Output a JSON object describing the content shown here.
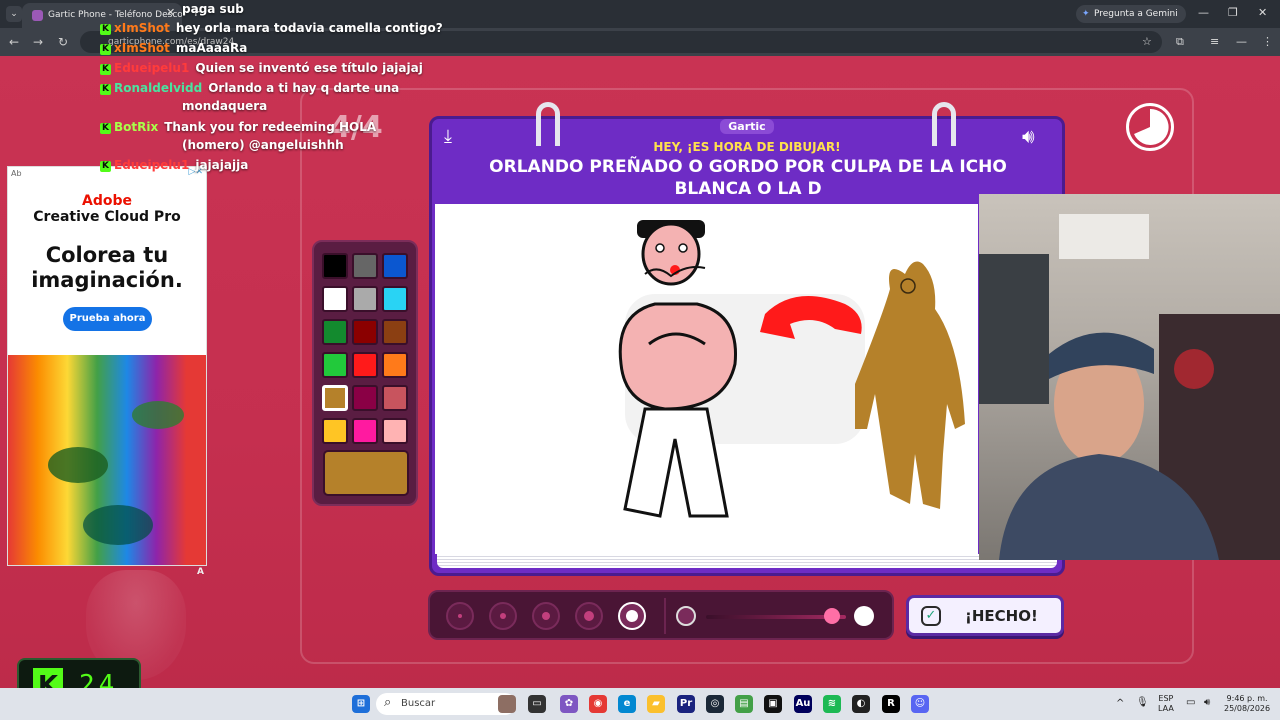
{
  "browser": {
    "tab_title": "Gartic Phone - Teléfono Descon",
    "url": "garticphone.com/es/draw24",
    "gemini_label": "Pregunta a Gemini"
  },
  "chat": [
    {
      "user": "",
      "user_color": "#ffffff",
      "message": "paga sub",
      "badge": false
    },
    {
      "user": "xImShot",
      "user_color": "#ff7a1a",
      "message": "hey orla mara todavia camella contigo?",
      "badge": true
    },
    {
      "user": "xImShot",
      "user_color": "#ff7a1a",
      "message": "maAaaaRa",
      "badge": true
    },
    {
      "user": "Edueipelu1",
      "user_color": "#ff3b3b",
      "message": "Quien se inventó ese título jajajaj",
      "badge": true
    },
    {
      "user": "Ronaldelvidd",
      "user_color": "#4ae3a0",
      "message": "Orlando a ti hay q darte una",
      "badge": true
    },
    {
      "user": "",
      "user_color": "#ffffff",
      "message": "mondaquera",
      "badge": false
    },
    {
      "user": "BotRix",
      "user_color": "#a8ff4a",
      "message": "Thank you for redeeming HOLA",
      "badge": true
    },
    {
      "user": "",
      "user_color": "#ffffff",
      "message": "(homero) @angeluishhh",
      "badge": false
    },
    {
      "user": "Edueipelu1",
      "user_color": "#ff3b3b",
      "message": "jajajajja",
      "badge": true
    }
  ],
  "ad": {
    "label": "Ab",
    "brand": "Adobe",
    "product": "Creative Cloud Pro",
    "headline_line1": "Colorea tu",
    "headline_line2": "imaginación.",
    "cta": "Prueba ahora",
    "corner": "A"
  },
  "kick_counter": {
    "value": "24"
  },
  "game": {
    "round": "4/4",
    "logo": "Gartic",
    "subtitle": "HEY, ¡ES HORA DE DIBUJAR!",
    "prompt_line1": "ORLANDO PREÑADO O GORDO POR CULPA DE LA ICHO",
    "prompt_line2": "BLANCA O LA D",
    "done_label": "¡HECHO!",
    "selected_color": "#b5812a",
    "palette": [
      "#000000",
      "#666666",
      "#0b57d0",
      "#ffffff",
      "#aaaaaa",
      "#29d3f4",
      "#138a2e",
      "#8b0000",
      "#8b3f12",
      "#22c93b",
      "#ff1a1a",
      "#ff7a1a",
      "#b5812a",
      "#8a0045",
      "#c8545e",
      "#ffc524",
      "#ff1aa0",
      "#ffb3b3"
    ],
    "brush_sizes": [
      1,
      2,
      3,
      4,
      5
    ],
    "selected_brush": 5,
    "opacity": 0.9
  },
  "taskbar": {
    "search_placeholder": "Buscar",
    "lang_top": "ESP",
    "lang_bottom": "LAA",
    "time": "9:46 p. m.",
    "date": "25/08/2026"
  }
}
